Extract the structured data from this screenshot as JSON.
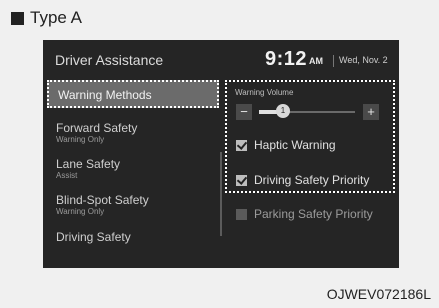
{
  "doc_label": "Type A",
  "screen": {
    "title": "Driver Assistance",
    "time": "9:12",
    "ampm": "AM",
    "date": "Wed, Nov. 2"
  },
  "menu": [
    {
      "label": "Warning Methods",
      "sub": "",
      "selected": true
    },
    {
      "label": "Forward Safety",
      "sub": "Warning Only",
      "selected": false
    },
    {
      "label": "Lane Safety",
      "sub": "Assist",
      "selected": false
    },
    {
      "label": "Blind-Spot Safety",
      "sub": "Warning Only",
      "selected": false
    },
    {
      "label": "Driving Safety",
      "sub": "",
      "selected": false
    }
  ],
  "panel": {
    "volume_label": "Warning Volume",
    "minus": "−",
    "plus": "+",
    "volume_value": "1",
    "volume_fraction": 0.25,
    "options": [
      {
        "label": "Haptic Warning",
        "checked": true
      },
      {
        "label": "Driving Safety Priority",
        "checked": true
      },
      {
        "label": "Parking Safety Priority",
        "checked": false
      }
    ]
  },
  "caption": "OJWEV072186L"
}
